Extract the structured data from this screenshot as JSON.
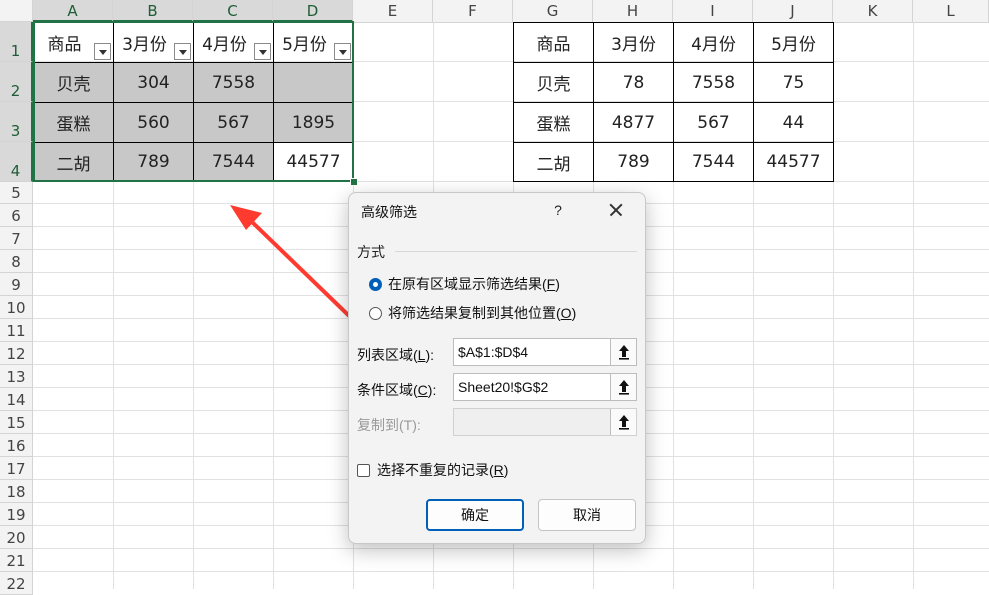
{
  "columns": [
    "A",
    "B",
    "C",
    "D",
    "E",
    "F",
    "G",
    "H",
    "I",
    "J",
    "K",
    "L"
  ],
  "rows": [
    "1",
    "2",
    "3",
    "4",
    "5",
    "6",
    "7",
    "8",
    "9",
    "10",
    "11",
    "12",
    "13",
    "14",
    "15",
    "16",
    "17",
    "18",
    "19",
    "20",
    "21",
    "22"
  ],
  "left_table": {
    "headers": [
      "商品",
      "3月份",
      "4月份",
      "5月份"
    ],
    "rows": [
      [
        "贝壳",
        "304",
        "7558",
        ""
      ],
      [
        "蛋糕",
        "560",
        "567",
        "1895"
      ],
      [
        "二胡",
        "789",
        "7544",
        "44577"
      ]
    ]
  },
  "right_table": {
    "headers": [
      "商品",
      "3月份",
      "4月份",
      "5月份"
    ],
    "rows": [
      [
        "贝壳",
        "78",
        "7558",
        "75"
      ],
      [
        "蛋糕",
        "4877",
        "567",
        "44"
      ],
      [
        "二胡",
        "789",
        "7544",
        "44577"
      ]
    ]
  },
  "dialog": {
    "title": "高级筛选",
    "help": "?",
    "section_label": "方式",
    "radio_in_place": {
      "text": "在原有区域显示筛选结果(",
      "key": "F",
      "end": ")"
    },
    "radio_copy": {
      "text": "将筛选结果复制到其他位置(",
      "key": "O",
      "end": ")"
    },
    "list_range": {
      "text": "列表区域(",
      "key": "L",
      "end": "):",
      "value": "$A$1:$D$4"
    },
    "criteria_range": {
      "text": "条件区域(",
      "key": "C",
      "end": "):",
      "value": "Sheet20!$G$2"
    },
    "copy_to": {
      "label": "复制到(T):",
      "value": ""
    },
    "unique": {
      "text": "选择不重复的记录(",
      "key": "R",
      "end": ")"
    },
    "ok": "确定",
    "cancel": "取消"
  },
  "colors": {
    "selection": "#217346",
    "arrow": "#ff3b30",
    "dialog_accent": "#005fb8",
    "filtered_fill": "#c8c8c8"
  }
}
